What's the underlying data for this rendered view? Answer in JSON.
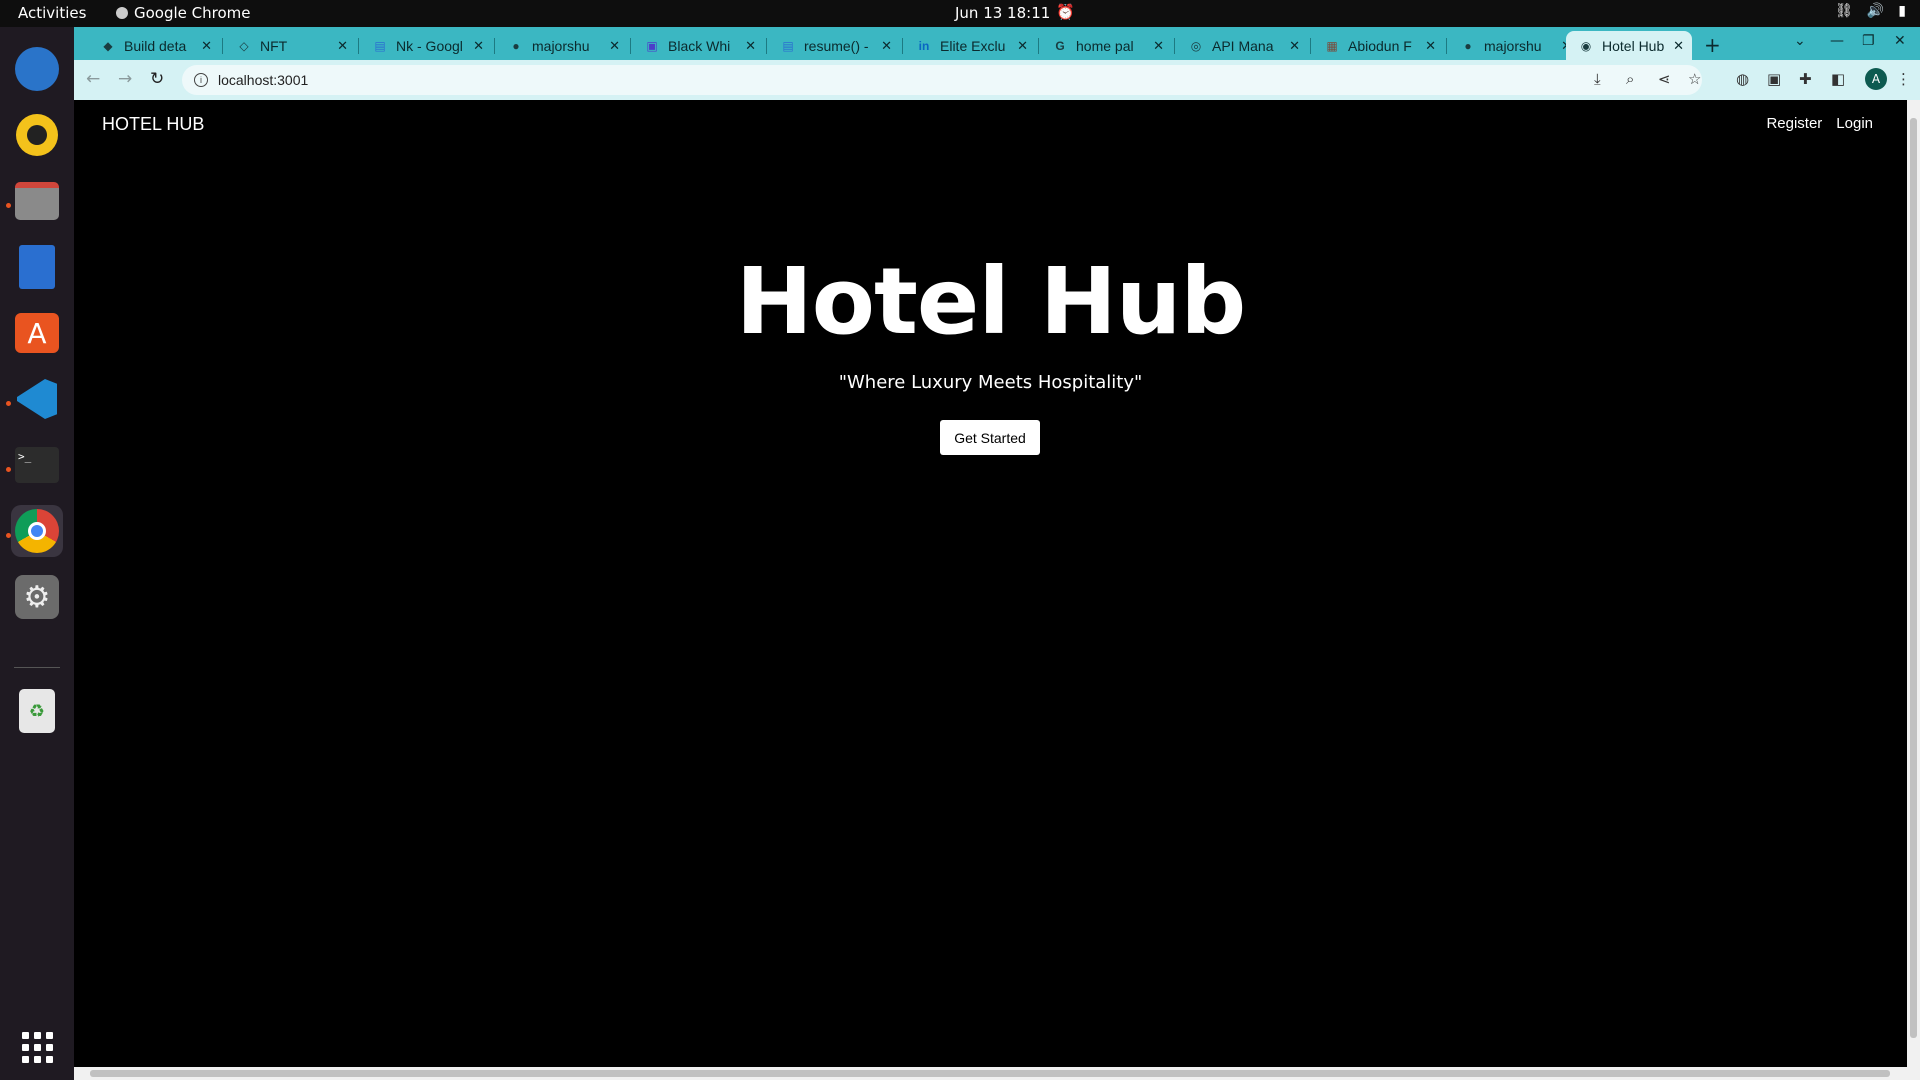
{
  "system": {
    "activities": "Activities",
    "app_name": "Google Chrome",
    "clock": "Jun 13  18:11"
  },
  "tabs": [
    {
      "label": "Build deta",
      "icon": "build-icon"
    },
    {
      "label": "NFT",
      "icon": "nft-icon"
    },
    {
      "label": "Nk - Googl",
      "icon": "docs-icon"
    },
    {
      "label": "majorshu",
      "icon": "github-icon"
    },
    {
      "label": "Black Whi",
      "icon": "print-icon"
    },
    {
      "label": "resume() -",
      "icon": "docs-icon"
    },
    {
      "label": "Elite Exclu",
      "icon": "linkedin-icon"
    },
    {
      "label": "home pal",
      "icon": "google-icon"
    },
    {
      "label": "API Mana",
      "icon": "api-icon"
    },
    {
      "label": "Abiodun F",
      "icon": "image-icon"
    },
    {
      "label": "majorshu",
      "icon": "github-icon"
    },
    {
      "label": "Hotel Hub",
      "icon": "react-icon"
    }
  ],
  "address_bar": {
    "url": "localhost:3001"
  },
  "profile_initial": "A",
  "site": {
    "brand": "HOTEL HUB",
    "nav": {
      "register": "Register",
      "login": "Login"
    },
    "hero": {
      "title": "Hotel Hub",
      "subtitle": "\"Where Luxury Meets Hospitality\"",
      "cta": "Get Started"
    }
  }
}
